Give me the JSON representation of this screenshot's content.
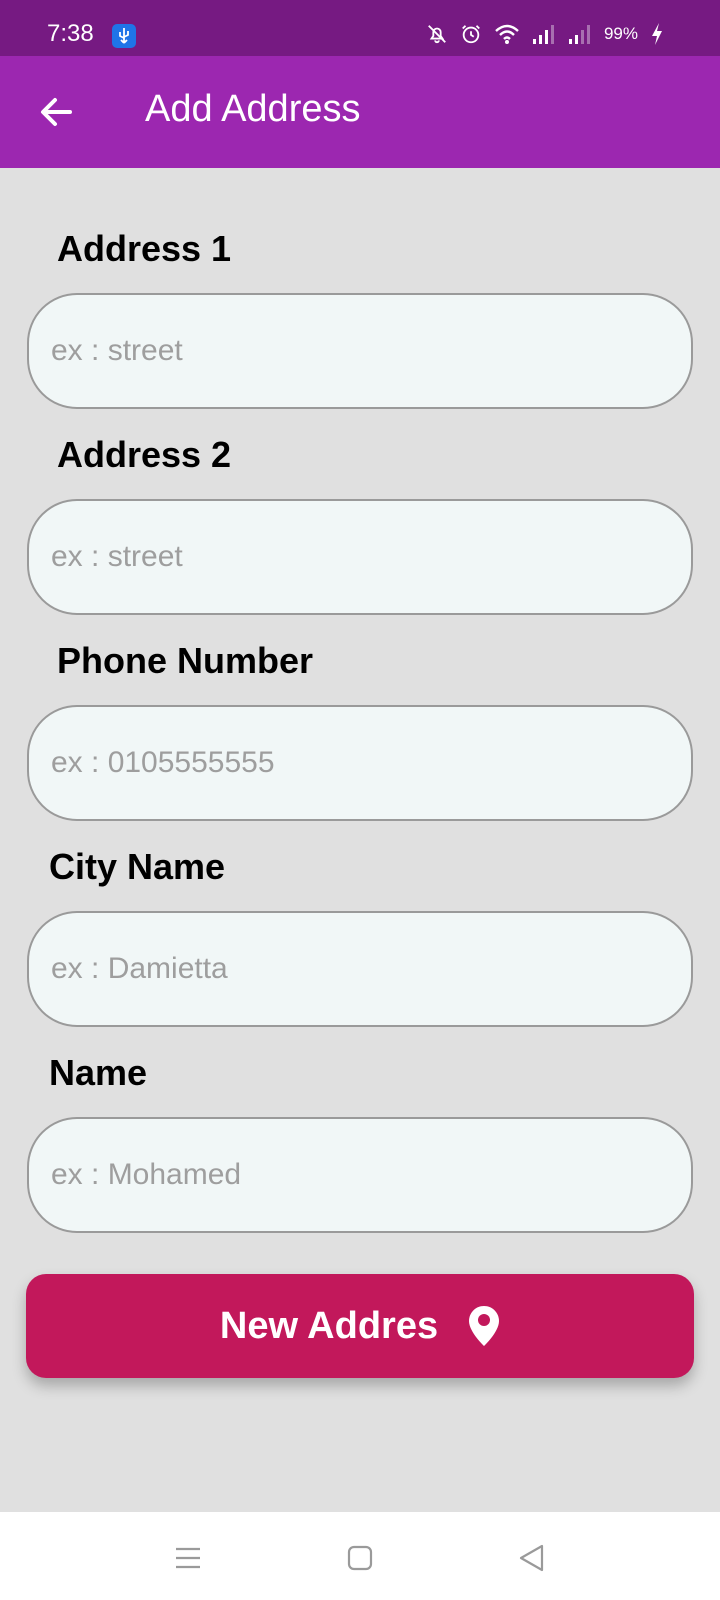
{
  "status_bar": {
    "time": "7:38",
    "battery": "99%",
    "icons": [
      "usb-icon",
      "bell-off-icon",
      "alarm-icon",
      "wifi-icon",
      "signal-1-icon",
      "signal-2-icon",
      "charging-icon"
    ]
  },
  "app_bar": {
    "title": "Add Address",
    "back_icon": "arrow-left-icon"
  },
  "form": {
    "fields": [
      {
        "label": "Address 1",
        "placeholder": "ex : street",
        "value": ""
      },
      {
        "label": "Address 2",
        "placeholder": "ex : street",
        "value": ""
      },
      {
        "label": "Phone Number",
        "placeholder": "ex : 0105555555",
        "value": ""
      },
      {
        "label": "City Name",
        "placeholder": "ex : Damietta",
        "value": ""
      },
      {
        "label": "Name",
        "placeholder": "ex : Mohamed",
        "value": ""
      }
    ],
    "submit": {
      "label": "New Addres",
      "icon": "location-pin-icon"
    }
  },
  "nav_bar": {
    "icons": [
      "menu-icon",
      "home-square-icon",
      "back-triangle-icon"
    ]
  },
  "colors": {
    "status_bar": "#761a82",
    "app_bar": "#9c27b0",
    "background": "#e0e0e0",
    "input_background": "#f1f7f7",
    "input_border": "#9a9a9a",
    "button": "#c2185b"
  }
}
